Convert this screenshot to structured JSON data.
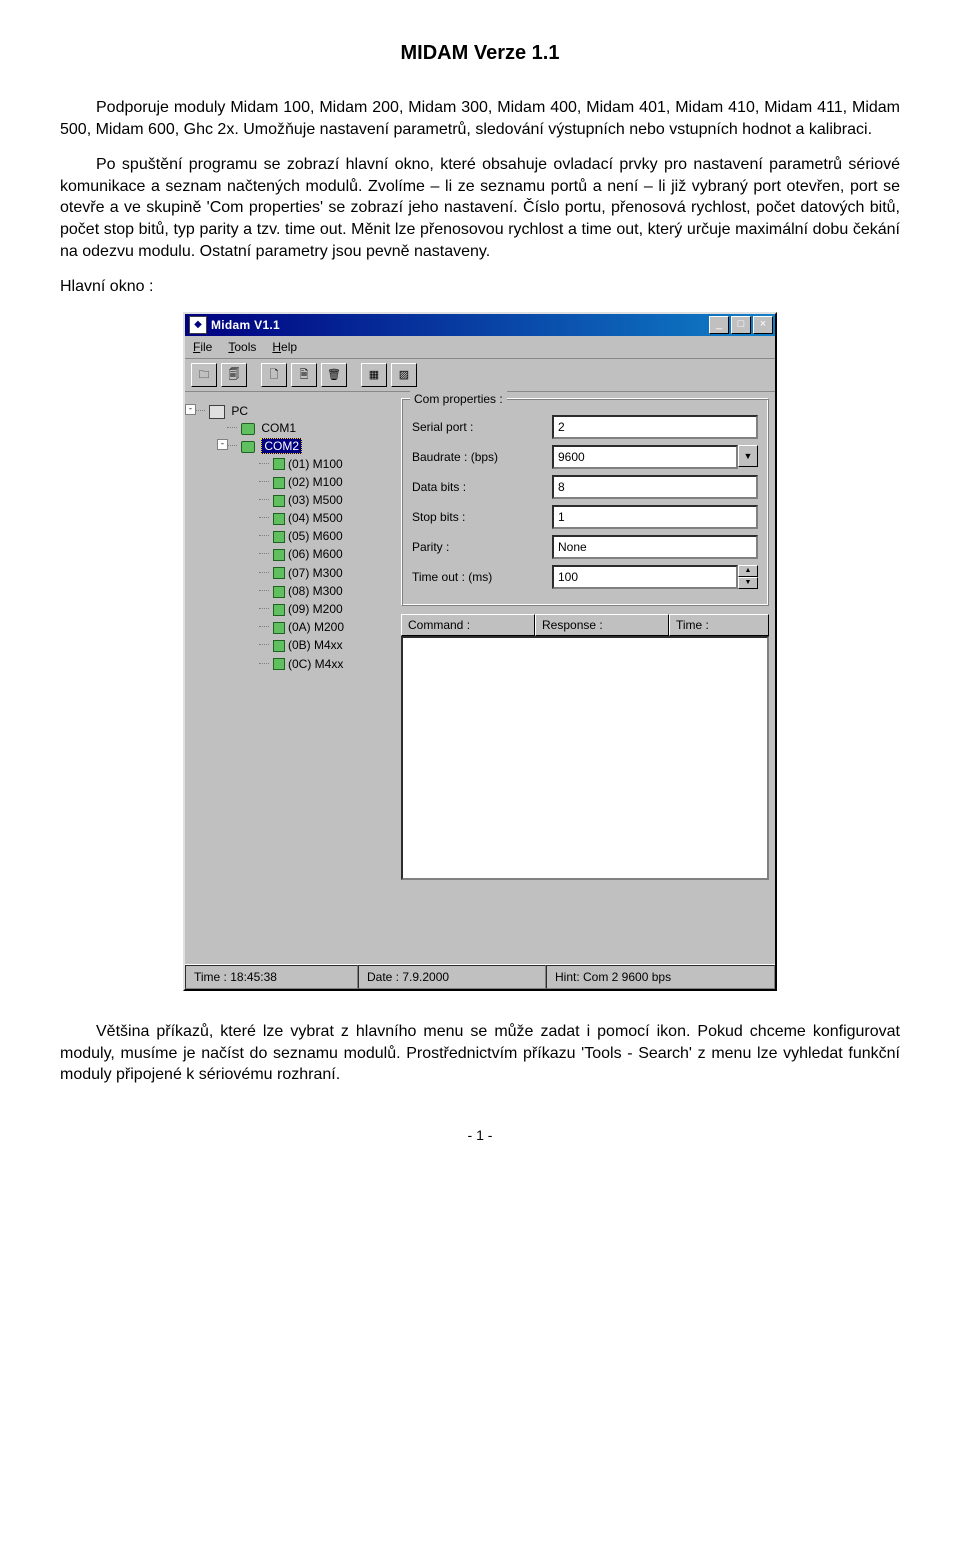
{
  "doc": {
    "title": "MIDAM Verze 1.1",
    "para1": "Podporuje moduly Midam 100, Midam 200, Midam 300, Midam 400, Midam 401, Midam 410, Midam 411, Midam 500, Midam 600, Ghc 2x. Umožňuje nastavení parametrů, sledování výstupních nebo vstupních hodnot a kalibraci.",
    "para2": "Po spuštění programu se zobrazí hlavní okno, které obsahuje ovladací prvky pro nastavení parametrů sériové komunikace a seznam načtených modulů. Zvolíme – li ze seznamu portů a není – li již vybraný port otevřen, port se otevře a ve skupině 'Com properties' se zobrazí jeho nastavení. Číslo portu, přenosová rychlost, počet datových bitů, počet stop bitů, typ parity a tzv. time out. Měnit lze přenosovou rychlost a time out, který určuje maximální dobu čekání na odezvu modulu. Ostatní parametry jsou pevně nastaveny.",
    "main_window_label": "Hlavní okno :",
    "para3": "Většina příkazů, které lze vybrat z hlavního menu se může zadat i pomocí ikon. Pokud chceme konfigurovat moduly, musíme je načíst do seznamu modulů. Prostřednictvím příkazu 'Tools - Search' z menu lze vyhledat funkční moduly připojené k sériovému rozhraní.",
    "page_number": "- 1 -"
  },
  "win": {
    "title": "Midam V1.1",
    "menu": {
      "file": "File",
      "tools": "Tools",
      "help": "Help"
    },
    "tree": {
      "root": "PC",
      "ports": [
        "COM1",
        "COM2"
      ],
      "selected": "COM2",
      "modules": [
        "(01) M100",
        "(02) M100",
        "(03) M500",
        "(04) M500",
        "(05) M600",
        "(06) M600",
        "(07) M300",
        "(08) M300",
        "(09) M200",
        "(0A) M200",
        "(0B) M4xx",
        "(0C) M4xx"
      ]
    },
    "props": {
      "legend": "Com properties :",
      "serial_label": "Serial port :",
      "serial_value": "2",
      "baud_label": "Baudrate :   (bps)",
      "baud_value": "9600",
      "data_label": "Data bits :",
      "data_value": "8",
      "stop_label": "Stop bits :",
      "stop_value": "1",
      "parity_label": "Parity :",
      "parity_value": "None",
      "timeout_label": "Time out :   (ms)",
      "timeout_value": "100"
    },
    "grid": {
      "c1": "Command :",
      "c2": "Response :",
      "c3": "Time :"
    },
    "status": {
      "time": "Time : 18:45:38",
      "date": "Date : 7.9.2000",
      "hint": "Hint: Com 2  9600 bps"
    }
  }
}
